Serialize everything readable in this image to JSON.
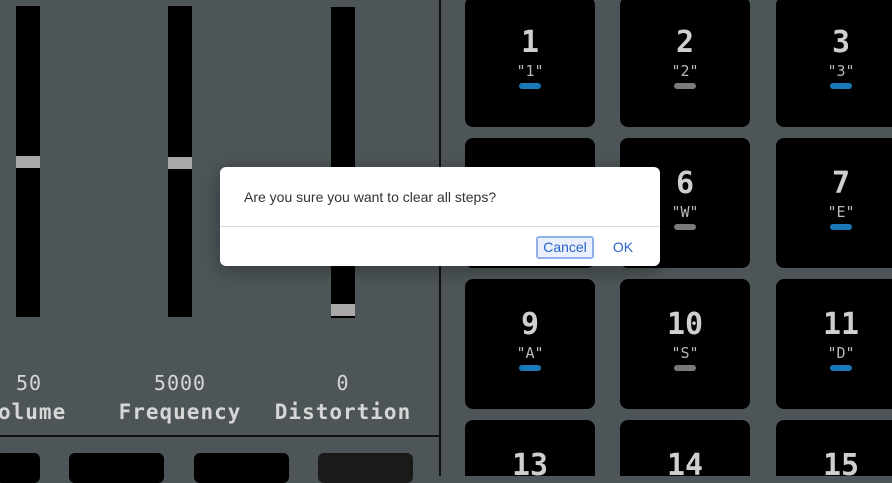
{
  "controls": {
    "volume": {
      "value_text": "50",
      "label": "olume",
      "level": 0.5
    },
    "frequency": {
      "value_text": "5000",
      "label": "Frequency",
      "level": 0.5
    },
    "distortion": {
      "value_text": "0",
      "label": "Distortion",
      "level": 0.0
    }
  },
  "pads": [
    {
      "number": "1",
      "key": "\"1\"",
      "led_color": "#1b78b8"
    },
    {
      "number": "2",
      "key": "\"2\"",
      "led_color": "#7a7a7a"
    },
    {
      "number": "3",
      "key": "\"3\"",
      "led_color": "#1b78b8"
    },
    {
      "number": "6",
      "key": "\"W\"",
      "led_color": "#7a7a7a"
    },
    {
      "number": "7",
      "key": "\"E\"",
      "led_color": "#1b78b8"
    },
    {
      "number": "9",
      "key": "\"A\"",
      "led_color": "#1b78b8"
    },
    {
      "number": "10",
      "key": "\"S\"",
      "led_color": "#7a7a7a"
    },
    {
      "number": "11",
      "key": "\"D\"",
      "led_color": "#1b78b8"
    },
    {
      "number": "13",
      "key": "",
      "led_color": ""
    },
    {
      "number": "14",
      "key": "",
      "led_color": ""
    },
    {
      "number": "15",
      "key": "",
      "led_color": ""
    }
  ],
  "dialog": {
    "message": "Are you sure you want to clear all steps?",
    "cancel_label": "Cancel",
    "ok_label": "OK"
  }
}
